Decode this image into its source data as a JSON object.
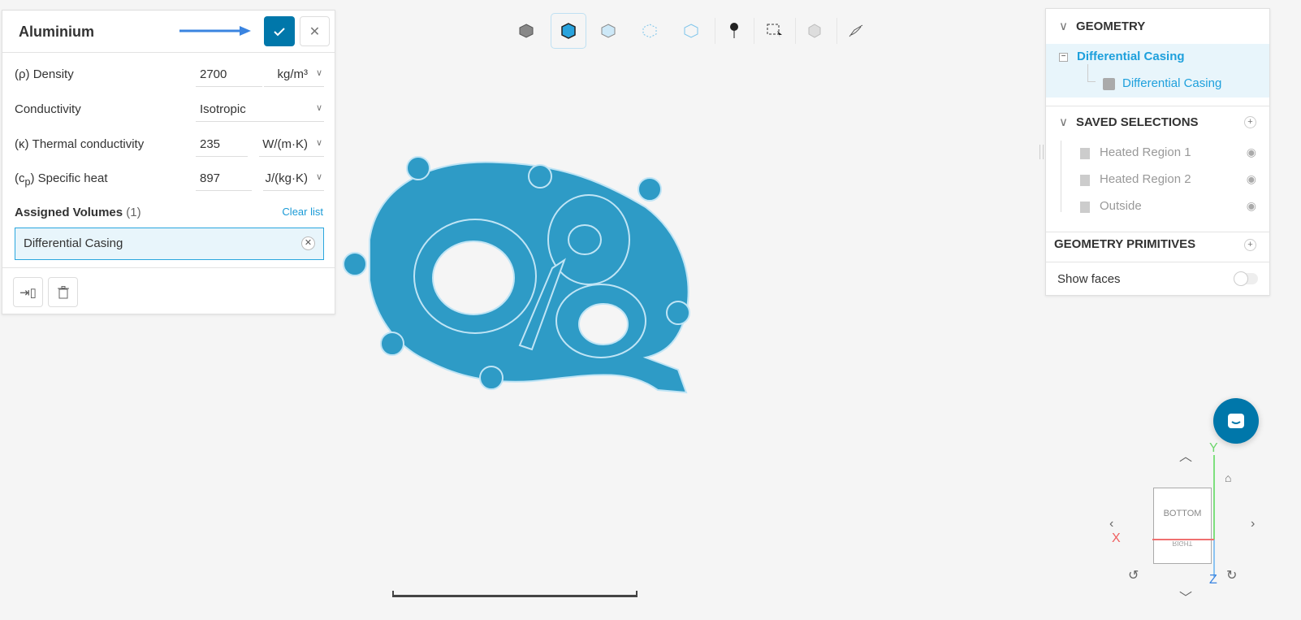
{
  "material": {
    "title": "Aluminium",
    "confirm_icon": "check-icon",
    "close_icon": "close-icon",
    "density_label": "(ρ) Density",
    "density_value": "2700",
    "density_unit": "kg/m³",
    "conductivity_label": "Conductivity",
    "conductivity_value": "Isotropic",
    "thermal_label": "(κ) Thermal conductivity",
    "thermal_value": "235",
    "thermal_unit": "W/(m·K)",
    "specific_label_pre": "(c",
    "specific_label_sub": "p",
    "specific_label_post": ") Specific heat",
    "specific_value": "897",
    "specific_unit": "J/(kg·K)",
    "assigned_label": "Assigned Volumes",
    "assigned_count": "(1)",
    "clear_list": "Clear list",
    "assigned_items": [
      "Differential Casing"
    ]
  },
  "tree": {
    "geometry": "GEOMETRY",
    "geometry_item": "Differential Casing",
    "geometry_child": "Differential Casing",
    "saved_selections": "SAVED SELECTIONS",
    "selections": [
      "Heated Region 1",
      "Heated Region 2",
      "Outside"
    ],
    "primitives": "GEOMETRY PRIMITIVES",
    "show_faces": "Show faces",
    "show_faces_on": false
  },
  "viewcube": {
    "face_front": "BOTTOM",
    "face_bottom": "RIGHT",
    "axis_x": "X",
    "axis_y": "Y",
    "axis_z": "Z"
  },
  "colors": {
    "accent": "#0077aa",
    "selection": "#1ea0dc",
    "model": "#2e9bc6"
  }
}
